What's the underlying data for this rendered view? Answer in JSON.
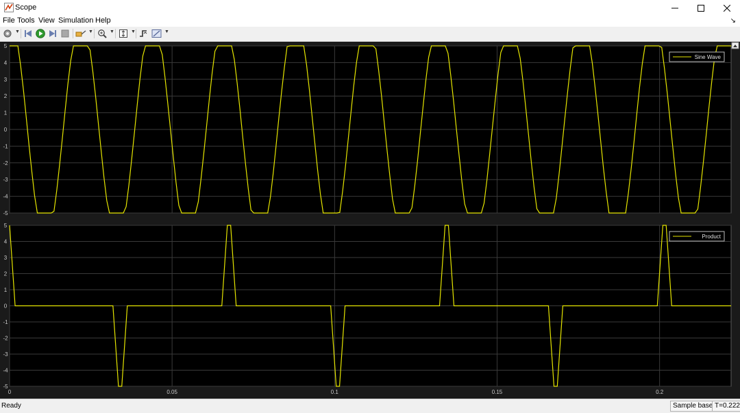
{
  "window": {
    "title": "Scope"
  },
  "menu": {
    "items": [
      "File",
      "Tools",
      "View",
      "Simulation",
      "Help"
    ]
  },
  "status": {
    "ready": "Ready",
    "mode": "Sample based",
    "time": "T=0.222"
  },
  "colors": {
    "trace": "#e6e600",
    "background": "#000000",
    "grid": "#3a3a3a",
    "axes_text": "#c8c8c8"
  },
  "chart_data": [
    {
      "type": "line",
      "series": [
        {
          "name": "Sine Wave"
        }
      ],
      "xlim": [
        0,
        0.222
      ],
      "ylim": [
        -5,
        5
      ],
      "xticks": [
        0,
        0.05,
        0.1,
        0.15,
        0.2
      ],
      "yticks": [
        5,
        4,
        3,
        2,
        1,
        0,
        -1,
        -2,
        -3,
        -4,
        -5
      ],
      "xtick_labels": [
        "",
        "",
        "",
        "",
        ""
      ],
      "ytick_labels": [
        "5",
        "4",
        "3",
        "2",
        "1",
        "0",
        "-1",
        "-2",
        "-3",
        "-4",
        "-5"
      ],
      "legend": "top-right",
      "grid": true,
      "signal": {
        "amplitude": 5,
        "period": 0.022,
        "clip": 5
      }
    },
    {
      "type": "line",
      "series": [
        {
          "name": "Product"
        }
      ],
      "xlim": [
        0,
        0.222
      ],
      "ylim": [
        -5,
        5
      ],
      "xticks": [
        0,
        0.05,
        0.1,
        0.15,
        0.2
      ],
      "yticks": [
        5,
        4,
        3,
        2,
        1,
        0,
        -1,
        -2,
        -3,
        -4,
        -5
      ],
      "xtick_labels": [
        "0",
        "0.05",
        "0.1",
        "0.15",
        "0.2"
      ],
      "ytick_labels": [
        "5",
        "4",
        "3",
        "2",
        "1",
        "0",
        "-1",
        "-2",
        "-3",
        "-4",
        "-5"
      ],
      "legend": "top-right",
      "grid": true,
      "pulses": [
        {
          "t": 0.0,
          "v": 5
        },
        {
          "t": 0.0335,
          "v": -5
        },
        {
          "t": 0.067,
          "v": 5
        },
        {
          "t": 0.1005,
          "v": -5
        },
        {
          "t": 0.134,
          "v": 5
        },
        {
          "t": 0.1675,
          "v": -5
        },
        {
          "t": 0.201,
          "v": 5
        }
      ],
      "pulse_halfwidth": 0.0017
    }
  ]
}
